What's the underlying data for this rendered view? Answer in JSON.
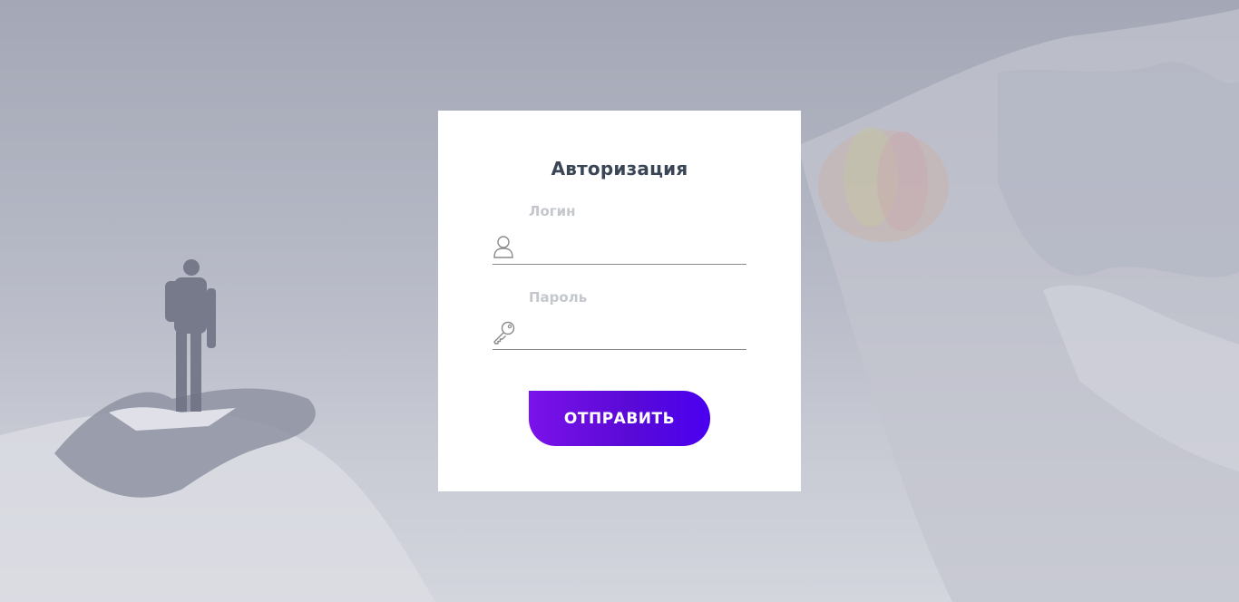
{
  "form": {
    "title": "Авторизация",
    "login": {
      "label": "Логин",
      "value": "",
      "icon": "user-icon"
    },
    "password": {
      "label": "Пароль",
      "value": "",
      "icon": "key-icon"
    },
    "submit_label": "ОТПРАВИТЬ"
  },
  "colors": {
    "accent_start": "#7b12ea",
    "accent_end": "#4a00f0",
    "title": "#3a4556",
    "label": "#c4c7cc"
  }
}
